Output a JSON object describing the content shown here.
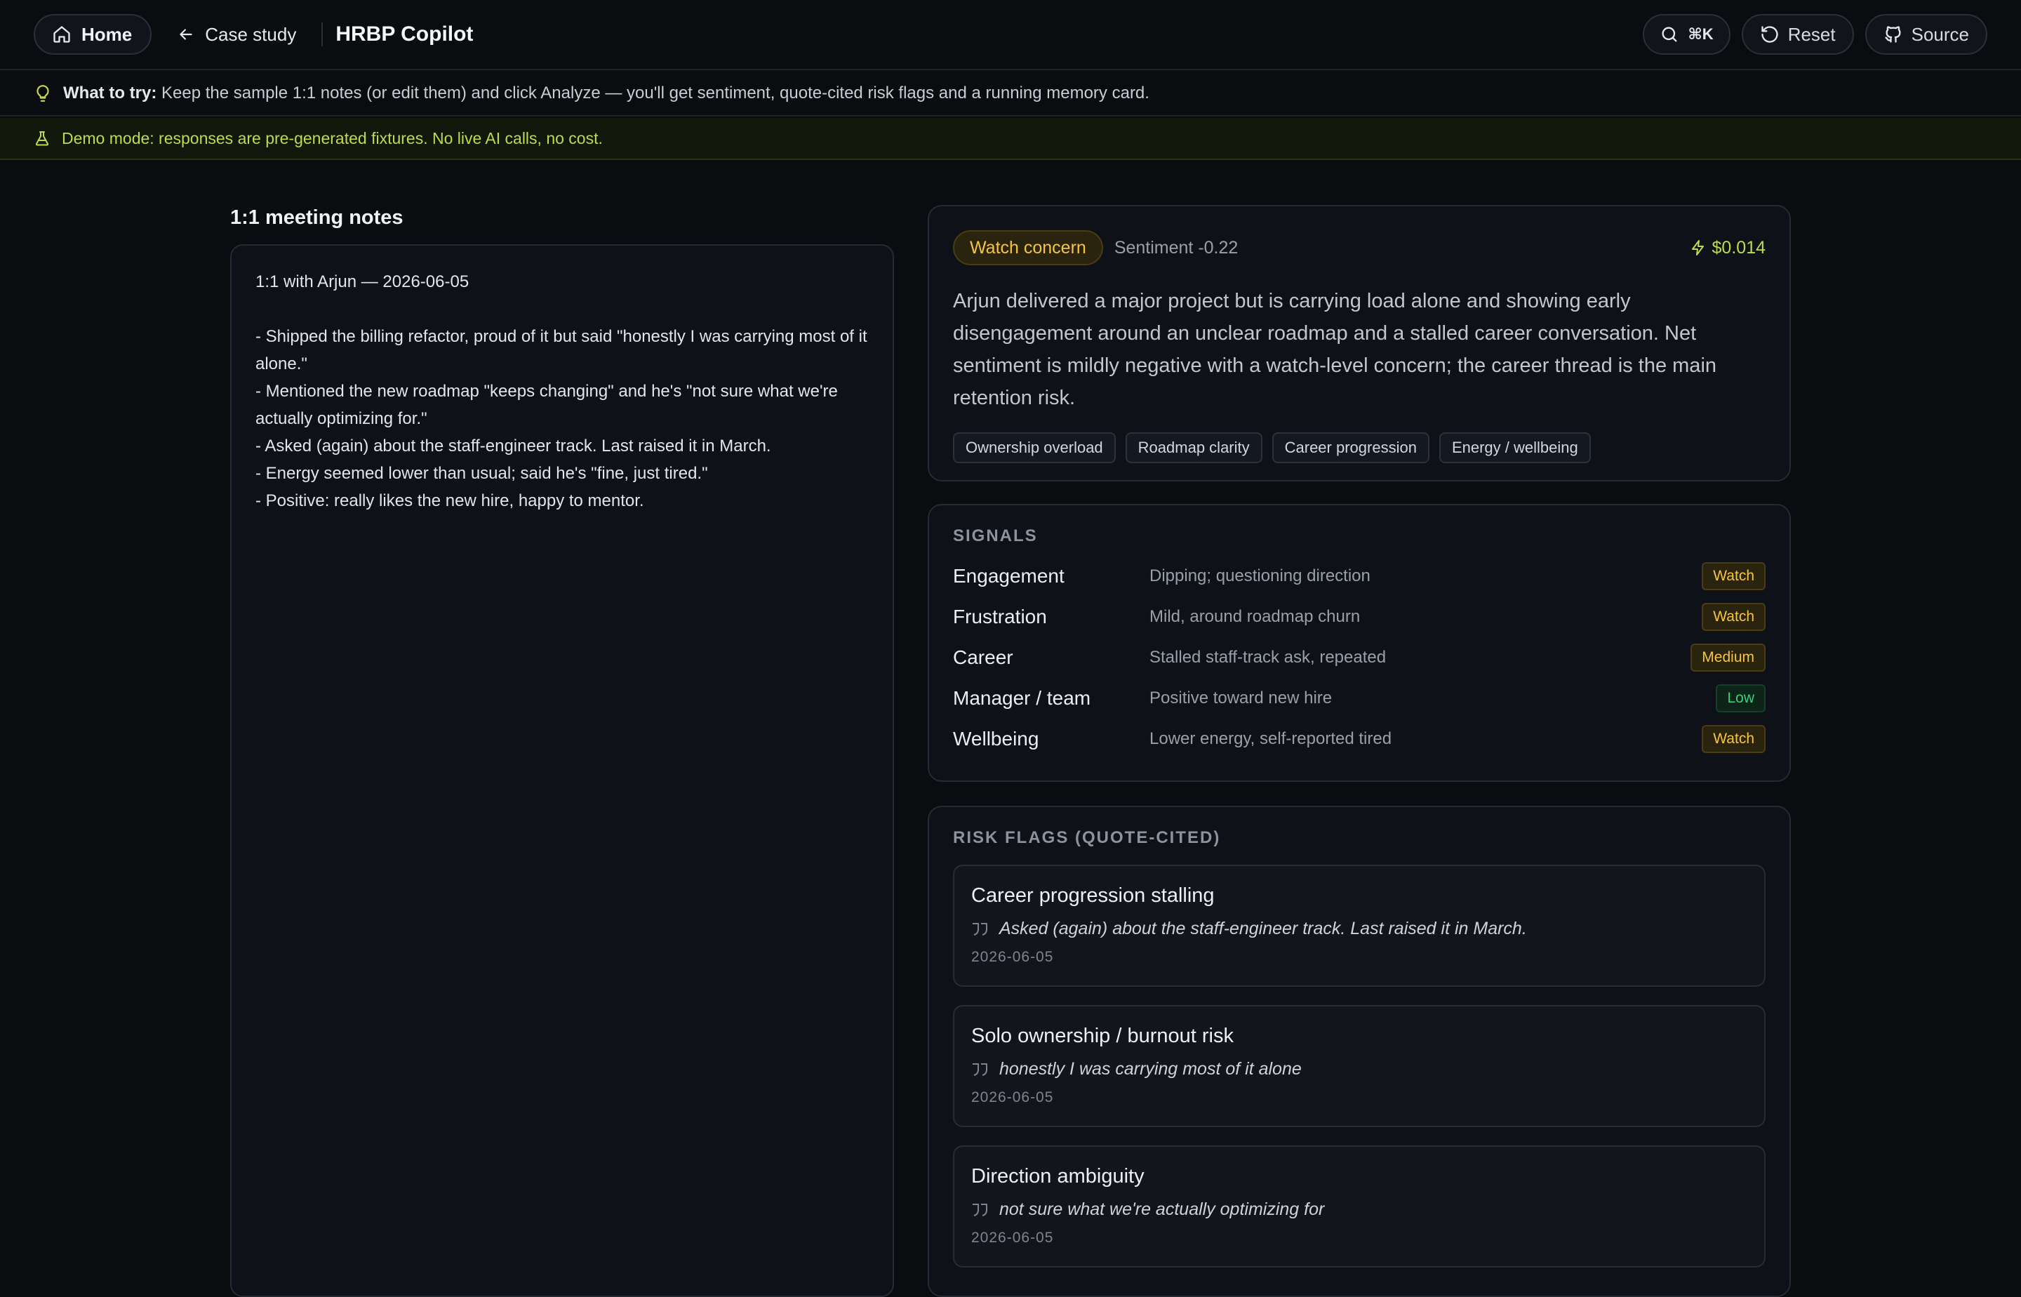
{
  "topbar": {
    "home_label": "Home",
    "back_label": "Case study",
    "app_title": "HRBP Copilot",
    "search_shortcut": "⌘K",
    "reset_label": "Reset",
    "source_label": "Source"
  },
  "tip": {
    "prefix": "What to try:",
    "text": "Keep the sample 1:1 notes (or edit them) and click Analyze — you'll get sentiment, quote-cited risk flags and a running memory card."
  },
  "demo": {
    "text": "Demo mode: responses are pre-generated fixtures. No live AI calls, no cost."
  },
  "notes": {
    "title": "1:1 meeting notes",
    "content": "1:1 with Arjun — 2026-06-05\n\n- Shipped the billing refactor, proud of it but said \"honestly I was carrying most of it alone.\"\n- Mentioned the new roadmap \"keeps changing\" and he's \"not sure what we're actually optimizing for.\"\n- Asked (again) about the staff-engineer track. Last raised it in March.\n- Energy seemed lower than usual; said he's \"fine, just tired.\"\n- Positive: really likes the new hire, happy to mentor."
  },
  "summary": {
    "badge": "Watch concern",
    "sentiment": "Sentiment -0.22",
    "cost": "$0.014",
    "text": "Arjun delivered a major project but is carrying load alone and showing early disengagement around an unclear roadmap and a stalled career conversation. Net sentiment is mildly negative with a watch-level concern; the career thread is the main retention risk.",
    "tags": [
      "Ownership overload",
      "Roadmap clarity",
      "Career progression",
      "Energy / wellbeing"
    ]
  },
  "signals": {
    "label": "SIGNALS",
    "rows": [
      {
        "name": "Engagement",
        "desc": "Dipping; questioning direction",
        "level": "Watch"
      },
      {
        "name": "Frustration",
        "desc": "Mild, around roadmap churn",
        "level": "Watch"
      },
      {
        "name": "Career",
        "desc": "Stalled staff-track ask, repeated",
        "level": "Medium"
      },
      {
        "name": "Manager / team",
        "desc": "Positive toward new hire",
        "level": "Low"
      },
      {
        "name": "Wellbeing",
        "desc": "Lower energy, self-reported tired",
        "level": "Watch"
      }
    ]
  },
  "risks": {
    "label": "RISK FLAGS (QUOTE-CITED)",
    "items": [
      {
        "title": "Career progression stalling",
        "quote": "Asked (again) about the staff-engineer track. Last raised it in March.",
        "date": "2026-06-05"
      },
      {
        "title": "Solo ownership / burnout risk",
        "quote": "honestly I was carrying most of it alone",
        "date": "2026-06-05"
      },
      {
        "title": "Direction ambiguity",
        "quote": "not sure what we're actually optimizing for",
        "date": "2026-06-05"
      }
    ]
  },
  "colors": {
    "background": "#0a0c10",
    "accent_lime": "#c3d94a",
    "watch_amber": "#f5c542",
    "low_green": "#3ecf7a"
  },
  "icons": [
    "home-icon",
    "arrow-left-icon",
    "search-icon",
    "reset-icon",
    "github-icon",
    "lightbulb-icon",
    "flask-icon",
    "lightning-icon",
    "quote-icon"
  ]
}
